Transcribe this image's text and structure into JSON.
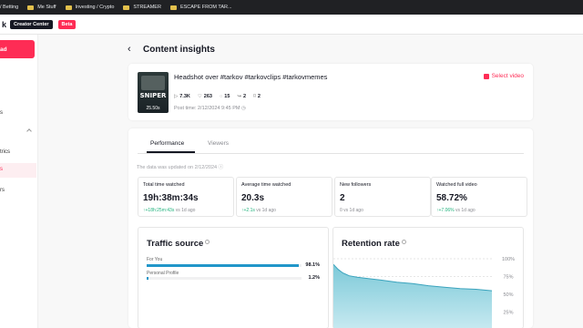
{
  "bookmarks": [
    {
      "label": "/ Betting",
      "icon": "folder-icon"
    },
    {
      "label": "Me Stuff",
      "icon": "folder-icon"
    },
    {
      "label": "Investing / Crypto",
      "icon": "folder-icon"
    },
    {
      "label": "STREAMER",
      "icon": "folder-icon"
    },
    {
      "label": "ESCAPE FROM TAR...",
      "icon": "folder-icon"
    }
  ],
  "header": {
    "creator_center": "Creator Center",
    "beta": "Beta"
  },
  "sidebar": {
    "upload": "ad",
    "items": [
      {
        "label": "s"
      },
      {
        "label": "trics"
      },
      {
        "label": "s"
      },
      {
        "label": "rs"
      }
    ]
  },
  "page": {
    "title": "Content insights"
  },
  "video": {
    "title": "Headshot over #tarkov #tarkovclips #tarkovmemes",
    "thumb_text": "SNIPER",
    "duration": "25.50s",
    "views": "7.3K",
    "likes": "263",
    "comments": "15",
    "shares": "2",
    "saves": "2",
    "post_time": "Post time: 2/12/2024 9:45 PM",
    "select_video": "Select video"
  },
  "tabs": {
    "performance": "Performance",
    "viewers": "Viewers"
  },
  "updated_note": "The data was updated on 2/12/2024",
  "metrics": [
    {
      "label": "Total time watched",
      "value": "19h:38m:34s",
      "delta": "+18h:25m:43s",
      "suffix": " vs 1d ago"
    },
    {
      "label": "Average time watched",
      "value": "20.3s",
      "delta": "+2.1s",
      "suffix": " vs 1d ago"
    },
    {
      "label": "New followers",
      "value": "2",
      "delta": "",
      "suffix": "0 vs 1d ago"
    },
    {
      "label": "Watched full video",
      "value": "58.72%",
      "delta": "+7.06%",
      "suffix": " vs 1d ago"
    }
  ],
  "traffic": {
    "title": "Traffic source",
    "sources": [
      {
        "label": "For You",
        "percent": "98.1%",
        "value": 98.1
      },
      {
        "label": "Personal Profile",
        "percent": "1.2%",
        "value": 1.2
      }
    ]
  },
  "retention": {
    "title": "Retention rate"
  },
  "chart_data": {
    "type": "area",
    "title": "Retention rate",
    "y_ticks": [
      "100%",
      "75%",
      "50%",
      "25%"
    ],
    "ylim": [
      0,
      100
    ],
    "x": [
      0,
      3,
      6,
      10,
      15,
      22,
      30,
      40,
      50,
      60,
      70,
      80,
      90,
      100
    ],
    "values": [
      92,
      85,
      80,
      76,
      74,
      72,
      70,
      67,
      65,
      62,
      60,
      58,
      57,
      55
    ]
  },
  "colors": {
    "accent": "#fe2c55",
    "bar": "#2196c9",
    "positive": "#20b27c",
    "area": "#7cc9d8"
  }
}
